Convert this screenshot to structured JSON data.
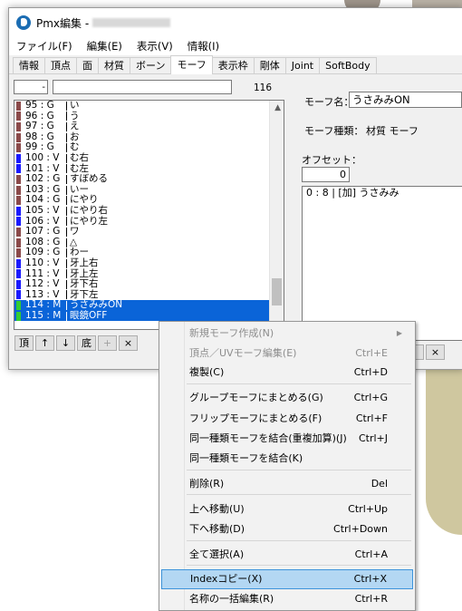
{
  "window": {
    "title": "Pmx編集 -"
  },
  "menu": [
    "ファイル(F)",
    "編集(E)",
    "表示(V)",
    "情報(I)"
  ],
  "tabs": [
    {
      "label": "情報",
      "active": false
    },
    {
      "label": "頂点",
      "active": false
    },
    {
      "label": "面",
      "active": false
    },
    {
      "label": "材質",
      "active": false
    },
    {
      "label": "ボーン",
      "active": false
    },
    {
      "label": "モーフ",
      "active": true
    },
    {
      "label": "表示枠",
      "active": false
    },
    {
      "label": "剛体",
      "active": false
    },
    {
      "label": "Joint",
      "active": false
    },
    {
      "label": "SoftBody",
      "active": false
    }
  ],
  "left": {
    "filter_value": "-",
    "count": "116",
    "rows": [
      {
        "idx": "95 : G",
        "name": "い",
        "color": "#8b4a4a",
        "selected": false
      },
      {
        "idx": "96 : G",
        "name": "う",
        "color": "#8b4a4a",
        "selected": false
      },
      {
        "idx": "97 : G",
        "name": "え",
        "color": "#8b4a4a",
        "selected": false
      },
      {
        "idx": "98 : G",
        "name": "お",
        "color": "#8b4a4a",
        "selected": false
      },
      {
        "idx": "99 : G",
        "name": "む",
        "color": "#8b4a4a",
        "selected": false
      },
      {
        "idx": "100 : V",
        "name": "む右",
        "color": "#1a1aff",
        "selected": false
      },
      {
        "idx": "101 : V",
        "name": "む左",
        "color": "#1a1aff",
        "selected": false
      },
      {
        "idx": "102 : G",
        "name": "すぼめる",
        "color": "#8b4a4a",
        "selected": false
      },
      {
        "idx": "103 : G",
        "name": "いー",
        "color": "#8b4a4a",
        "selected": false
      },
      {
        "idx": "104 : G",
        "name": "にやり",
        "color": "#8b4a4a",
        "selected": false
      },
      {
        "idx": "105 : V",
        "name": "にやり右",
        "color": "#1a1aff",
        "selected": false
      },
      {
        "idx": "106 : V",
        "name": "にやり左",
        "color": "#1a1aff",
        "selected": false
      },
      {
        "idx": "107 : G",
        "name": "ワ",
        "color": "#8b4a4a",
        "selected": false
      },
      {
        "idx": "108 : G",
        "name": "△",
        "color": "#8b4a4a",
        "selected": false
      },
      {
        "idx": "109 : G",
        "name": "わー",
        "color": "#8b4a4a",
        "selected": false
      },
      {
        "idx": "110 : V",
        "name": "牙上右",
        "color": "#1a1aff",
        "selected": false
      },
      {
        "idx": "111 : V",
        "name": "牙上左",
        "color": "#1a1aff",
        "selected": false
      },
      {
        "idx": "112 : V",
        "name": "牙下右",
        "color": "#1a1aff",
        "selected": false
      },
      {
        "idx": "113 : V",
        "name": "牙下左",
        "color": "#1a1aff",
        "selected": false
      },
      {
        "idx": "114 : M",
        "name": "うさみみON",
        "color": "#33cc33",
        "selected": true
      },
      {
        "idx": "115 : M",
        "name": "眼鏡OFF",
        "color": "#33cc33",
        "selected": true
      }
    ],
    "buttons": [
      {
        "label": "頂",
        "icon": "top-icon",
        "disabled": false
      },
      {
        "label": "↑",
        "icon": "arrow-up-icon",
        "disabled": false
      },
      {
        "label": "↓",
        "icon": "arrow-down-icon",
        "disabled": false
      },
      {
        "label": "底",
        "icon": "bottom-icon",
        "disabled": false
      },
      {
        "label": "+",
        "icon": "plus-icon",
        "disabled": true
      },
      {
        "label": "×",
        "icon": "close-icon",
        "disabled": false
      }
    ]
  },
  "right": {
    "morph_name_label": "モーフ名：",
    "morph_name_value": "うさみみON",
    "morph_type_label": "モーフ種類：",
    "morph_type_value": "材質 モーフ",
    "offset_label": "オフセット：",
    "offset_value": "0",
    "offset_rows": [
      {
        "index": "0 : 8",
        "mode": "[加]",
        "name": "うさみみ"
      }
    ],
    "delete_button": "×"
  },
  "context_menu": {
    "items": [
      {
        "label": "新規モーフ作成(N)",
        "shortcut": "",
        "disabled": true,
        "submenu": true
      },
      {
        "label": "頂点／UVモーフ編集(E)",
        "shortcut": "Ctrl+E",
        "disabled": true
      },
      {
        "label": "複製(C)",
        "shortcut": "Ctrl+D",
        "disabled": false
      },
      {
        "label": "グループモーフにまとめる(G)",
        "shortcut": "Ctrl+G",
        "disabled": false
      },
      {
        "label": "フリップモーフにまとめる(F)",
        "shortcut": "Ctrl+F",
        "disabled": false
      },
      {
        "label": "同一種類モーフを結合(重複加算)(J)",
        "shortcut": "Ctrl+J",
        "disabled": false
      },
      {
        "label": "同一種類モーフを結合(K)",
        "shortcut": "",
        "disabled": false
      },
      {
        "label": "削除(R)",
        "shortcut": "Del",
        "disabled": false
      },
      {
        "label": "上へ移動(U)",
        "shortcut": "Ctrl+Up",
        "disabled": false
      },
      {
        "label": "下へ移動(D)",
        "shortcut": "Ctrl+Down",
        "disabled": false
      },
      {
        "label": "全て選択(A)",
        "shortcut": "Ctrl+A",
        "disabled": false
      },
      {
        "label": "Indexコピー(X)",
        "shortcut": "Ctrl+X",
        "disabled": false,
        "highlighted": true
      },
      {
        "label": "名称の一括編集(R)",
        "shortcut": "Ctrl+R",
        "disabled": false
      }
    ]
  }
}
